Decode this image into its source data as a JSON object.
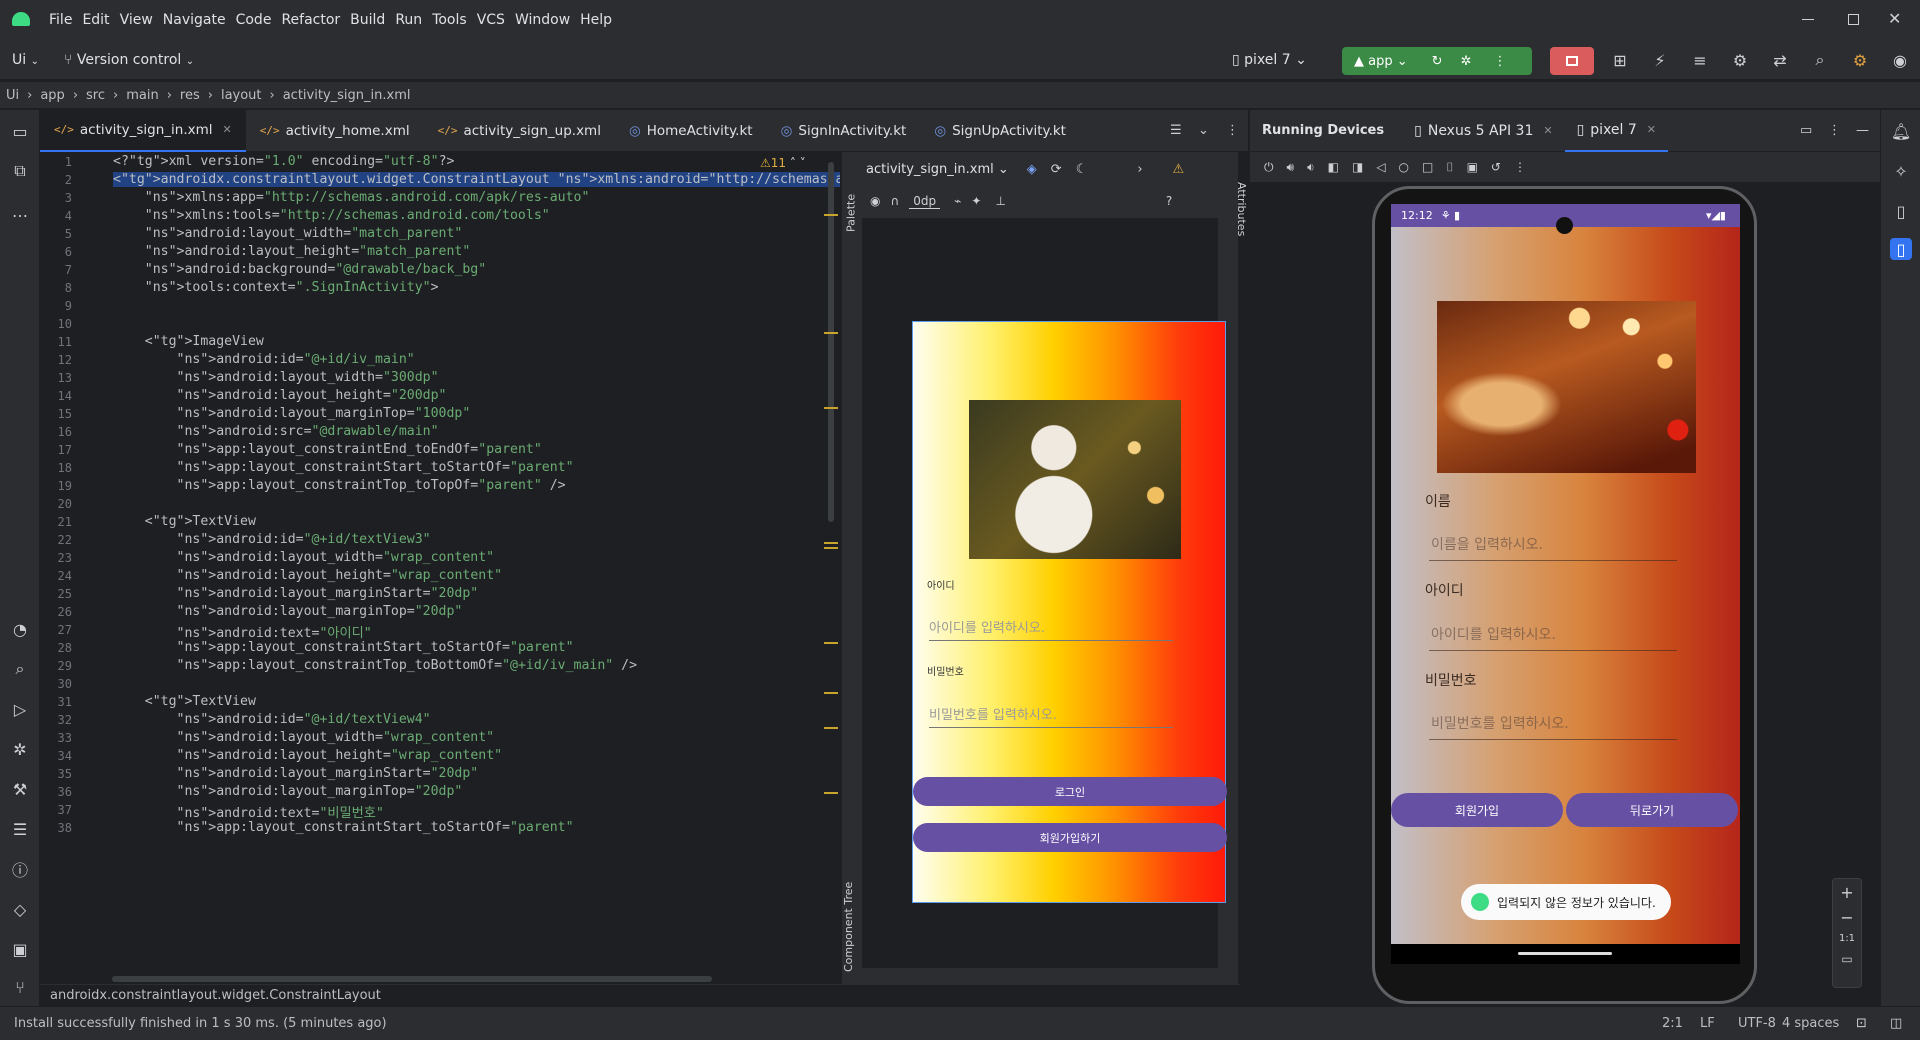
{
  "menu": [
    "File",
    "Edit",
    "View",
    "Navigate",
    "Code",
    "Refactor",
    "Build",
    "Run",
    "Tools",
    "VCS",
    "Window",
    "Help"
  ],
  "toolbar": {
    "project": "Ui",
    "vcs": "Version control",
    "device": "pixel 7",
    "run_config": "app"
  },
  "breadcrumb": [
    "Ui",
    "app",
    "src",
    "main",
    "res",
    "layout",
    "activity_sign_in.xml"
  ],
  "editor_tabs": [
    {
      "label": "activity_sign_in.xml",
      "kind": "xml",
      "active": true
    },
    {
      "label": "activity_home.xml",
      "kind": "xml"
    },
    {
      "label": "activity_sign_up.xml",
      "kind": "xml"
    },
    {
      "label": "HomeActivity.kt",
      "kind": "kt"
    },
    {
      "label": "SignInActivity.kt",
      "kind": "kt"
    },
    {
      "label": "SignUpActivity.kt",
      "kind": "kt"
    }
  ],
  "warnings_count": "11",
  "code_lines": [
    "<?xml version=\"1.0\" encoding=\"utf-8\"?>",
    "<androidx.constraintlayout.widget.ConstraintLayout xmlns:android=\"http://schemas.android.co",
    "    xmlns:app=\"http://schemas.android.com/apk/res-auto\"",
    "    xmlns:tools=\"http://schemas.android.com/tools\"",
    "    android:layout_width=\"match_parent\"",
    "    android:layout_height=\"match_parent\"",
    "    android:background=\"@drawable/back_bg\"",
    "    tools:context=\".SignInActivity\">",
    "",
    "",
    "    <ImageView",
    "        android:id=\"@+id/iv_main\"",
    "        android:layout_width=\"300dp\"",
    "        android:layout_height=\"200dp\"",
    "        android:layout_marginTop=\"100dp\"",
    "        android:src=\"@drawable/main\"",
    "        app:layout_constraintEnd_toEndOf=\"parent\"",
    "        app:layout_constraintStart_toStartOf=\"parent\"",
    "        app:layout_constraintTop_toTopOf=\"parent\" />",
    "",
    "    <TextView",
    "        android:id=\"@+id/textView3\"",
    "        android:layout_width=\"wrap_content\"",
    "        android:layout_height=\"wrap_content\"",
    "        android:layout_marginStart=\"20dp\"",
    "        android:layout_marginTop=\"20dp\"",
    "        android:text=\"아이디\"",
    "        app:layout_constraintStart_toStartOf=\"parent\"",
    "        app:layout_constraintTop_toBottomOf=\"@+id/iv_main\" />",
    "",
    "    <TextView",
    "        android:id=\"@+id/textView4\"",
    "        android:layout_width=\"wrap_content\"",
    "        android:layout_height=\"wrap_content\"",
    "        android:layout_marginStart=\"20dp\"",
    "        android:layout_marginTop=\"20dp\"",
    "        android:text=\"비밀번호\"",
    "        app:layout_constraintStart_toStartOf=\"parent\""
  ],
  "design": {
    "file_dropdown": "activity_sign_in.xml",
    "margin": "0dp",
    "palette": "Palette",
    "component_tree": "Component Tree",
    "attributes": "Attributes",
    "preview": {
      "id_label": "아이디",
      "id_hint": "아이디를 입력하시오.",
      "pw_label": "비밀번호",
      "pw_hint": "비밀번호를 입력하시오.",
      "login_button": "로그인",
      "signup_button": "회원가입하기"
    }
  },
  "running_devices": {
    "title": "Running Devices",
    "tabs": [
      "Nexus 5 API 31",
      "pixel 7"
    ],
    "status_time": "12:12",
    "screen": {
      "name_label": "이름",
      "name_hint": "이름을 입력하시오.",
      "id_label": "아이디",
      "id_hint": "아이디를 입력하시오.",
      "pw_label": "비밀번호",
      "pw_hint": "비밀번호를 입력하시오.",
      "signup_button": "회원가입",
      "back_button": "뒤로가기",
      "toast": "입력되지 않은 정보가 있습니다."
    },
    "zoom_reset": "1:1"
  },
  "footer_breadcrumb": "androidx.constraintlayout.widget.ConstraintLayout",
  "status": {
    "message": "Install successfully finished in 1 s 30 ms. (5 minutes ago)",
    "position": "2:1",
    "line_sep": "LF",
    "encoding": "UTF-8",
    "indent": "4 spaces"
  }
}
